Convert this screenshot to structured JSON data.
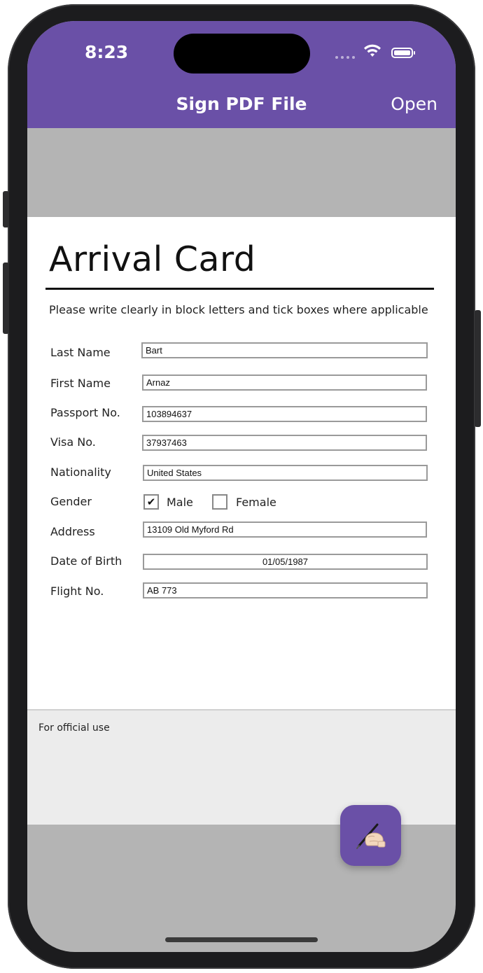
{
  "status_bar": {
    "time": "8:23",
    "icons": [
      "signal-dots-icon",
      "wifi-icon",
      "battery-icon"
    ]
  },
  "nav": {
    "title": "Sign PDF File",
    "open_label": "Open"
  },
  "document": {
    "title": "Arrival Card",
    "instructions": "Please write clearly in block letters and tick boxes where applicable",
    "fields": [
      {
        "label": "Last Name",
        "value": "Bart"
      },
      {
        "label": "First Name",
        "value": "Arnaz"
      },
      {
        "label": "Passport No.",
        "value": "103894637"
      },
      {
        "label": "Visa No.",
        "value": "37937463"
      },
      {
        "label": "Nationality",
        "value": "United States"
      },
      {
        "label": "Address",
        "value": "13109 Old Myford Rd"
      },
      {
        "label": "Date of Birth",
        "value": "01/05/1987"
      },
      {
        "label": "Flight No.",
        "value": "AB 773"
      }
    ],
    "gender": {
      "label": "Gender",
      "options": [
        {
          "label": "Male",
          "checked": true,
          "mark": "✔"
        },
        {
          "label": "Female",
          "checked": false,
          "mark": ""
        }
      ]
    },
    "official_label": "For official use"
  },
  "fab": {
    "icon": "writing-hand-icon",
    "glyph": "✍🏻"
  },
  "colors": {
    "accent": "#6a50a7",
    "pdf_background": "#b4b4b4"
  }
}
